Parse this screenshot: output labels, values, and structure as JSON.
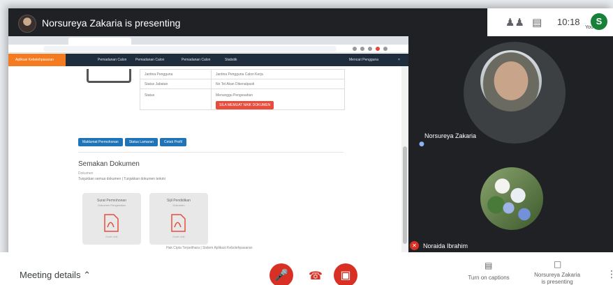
{
  "topbar": {
    "presenting_title": "Norsureya Zakaria is presenting",
    "clock": "10:18",
    "you_label": "You",
    "user_initial": "S",
    "people_icon": "people-icon",
    "chat_icon": "chat-icon"
  },
  "participants": {
    "main_name": "Norsureya Zakaria",
    "second_name": "Noraida Ibrahim"
  },
  "shared_screen": {
    "nav_brand": "Aplikasi Kebolehpasaran",
    "nav_items": [
      "Pemadanan Calon",
      "Pemadanan Calon",
      "Pemadanan Calon",
      "Statistik"
    ],
    "nav_user": "Mencari Pengguna",
    "table_rows": [
      {
        "label": "Jantina Pengguna",
        "value": "Jantina Pengguna Calon Kerja"
      },
      {
        "label": "Status Jabatan",
        "value": "No Tel Akan Dikenalpasti"
      },
      {
        "label": "Status",
        "value": "Menunggu Pengesahan"
      }
    ],
    "red_button": "SILA MEMUAT NAIK DOKUMEN",
    "blue_buttons": [
      "Maklumat Permohonan",
      "Status Lamaran",
      "Cetak Profil"
    ],
    "section_title": "Semakan Dokumen",
    "section_sub": "Dokumen",
    "radio_text": "Tunjukkan semua dokumen  |  Tunjukkan dokumen terkini",
    "cards": [
      {
        "title": "Surat Permohonan",
        "sub": "Dokumen Pengenalan",
        "foot": "Muat naik"
      },
      {
        "title": "Sijil Pendidikan",
        "sub": "Dokumen",
        "foot": "Muat naik"
      }
    ],
    "footer": "Hak Cipta Terpelihara | Sistem Aplikasi Kebolehpasaran"
  },
  "bottombar": {
    "meeting_details": "Meeting details",
    "captions_label": "Turn on captions",
    "presenting_label": "Norsureya Zakaria is presenting"
  },
  "colors": {
    "accent_red": "#d93025",
    "meet_dark": "#202124",
    "nav_orange": "#f47b20",
    "nav_dark": "#1f2d3d",
    "button_blue": "#1f73b7"
  }
}
